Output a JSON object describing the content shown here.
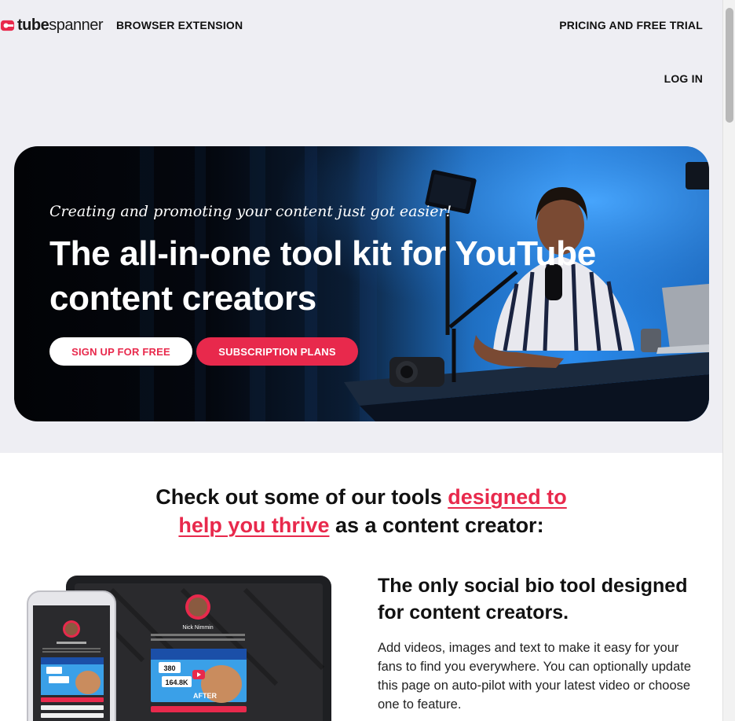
{
  "header": {
    "logo": {
      "bold": "tube",
      "regular": "spanner"
    },
    "nav": {
      "extension": "BROWSER EXTENSION",
      "pricing": "PRICING AND FREE TRIAL",
      "login": "LOG IN"
    }
  },
  "hero": {
    "tagline": "Creating and promoting your content just got easier!",
    "title": "The all-in-one tool kit for YouTube content creators",
    "signup_label": "SIGN UP FOR FREE",
    "plans_label": "SUBSCRIPTION PLANS"
  },
  "tools": {
    "heading_before": "Check out some of our tools ",
    "heading_accent": "designed to help you thrive",
    "heading_after": " as a content creator:",
    "feature_title": "The only social bio tool designed for content creators.",
    "feature_text": "Add videos, images and text to make it easy for your fans to find you everywhere. You can optionally update this page on auto-pilot with your latest video or choose one to feature.",
    "mockup": {
      "profile_name": "Nick Nimmin",
      "badge_left": "380",
      "badge_right": "164.8K",
      "after_label": "AFTER"
    }
  },
  "colors": {
    "accent": "#e8294c",
    "page_bg": "#eeeef3",
    "hero_blue": "#2a8bec"
  },
  "icons": [
    "tubespanner-logo-icon",
    "play-icon"
  ]
}
